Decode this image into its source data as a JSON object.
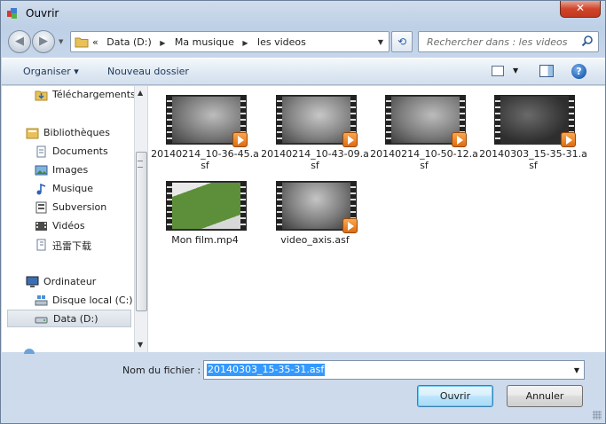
{
  "window": {
    "title": "Ouvrir",
    "close": "✕"
  },
  "address": {
    "overflow": "«",
    "crumbs": [
      "Data (D:)",
      "Ma musique",
      "les videos"
    ]
  },
  "search": {
    "placeholder": "Rechercher dans : les videos"
  },
  "toolbar": {
    "organise": "Organiser ▾",
    "new_folder": "Nouveau dossier",
    "help": "?"
  },
  "nav": {
    "items": [
      {
        "label": "Téléchargements",
        "icon": "download-folder-icon"
      },
      {
        "label": "Bibliothèques",
        "icon": "libraries-icon"
      },
      {
        "label": "Documents",
        "icon": "documents-icon"
      },
      {
        "label": "Images",
        "icon": "images-icon"
      },
      {
        "label": "Musique",
        "icon": "music-icon"
      },
      {
        "label": "Subversion",
        "icon": "subversion-icon"
      },
      {
        "label": "Vidéos",
        "icon": "videos-icon"
      },
      {
        "label": "迅雷下载",
        "icon": "thunder-download-icon"
      },
      {
        "label": "Ordinateur",
        "icon": "computer-icon"
      },
      {
        "label": "Disque local (C:)",
        "icon": "local-disk-icon"
      },
      {
        "label": "Data (D:)",
        "icon": "drive-icon"
      }
    ]
  },
  "files": [
    {
      "name": "20140214_10-36-45.asf",
      "thumb": "gray"
    },
    {
      "name": "20140214_10-43-09.asf",
      "thumb": "gray"
    },
    {
      "name": "20140214_10-50-12.asf",
      "thumb": "gray"
    },
    {
      "name": "20140303_15-35-31.asf",
      "thumb": "dark"
    },
    {
      "name": "Mon film.mp4",
      "thumb": "green"
    },
    {
      "name": "video_axis.asf",
      "thumb": "gray"
    }
  ],
  "bottom": {
    "filename_label": "Nom du fichier :",
    "filename_value": "20140303_15-35-31.asf",
    "open": "Ouvrir",
    "cancel": "Annuler"
  },
  "colors": {
    "selection": "#3399ff",
    "close": "#c3391f"
  }
}
